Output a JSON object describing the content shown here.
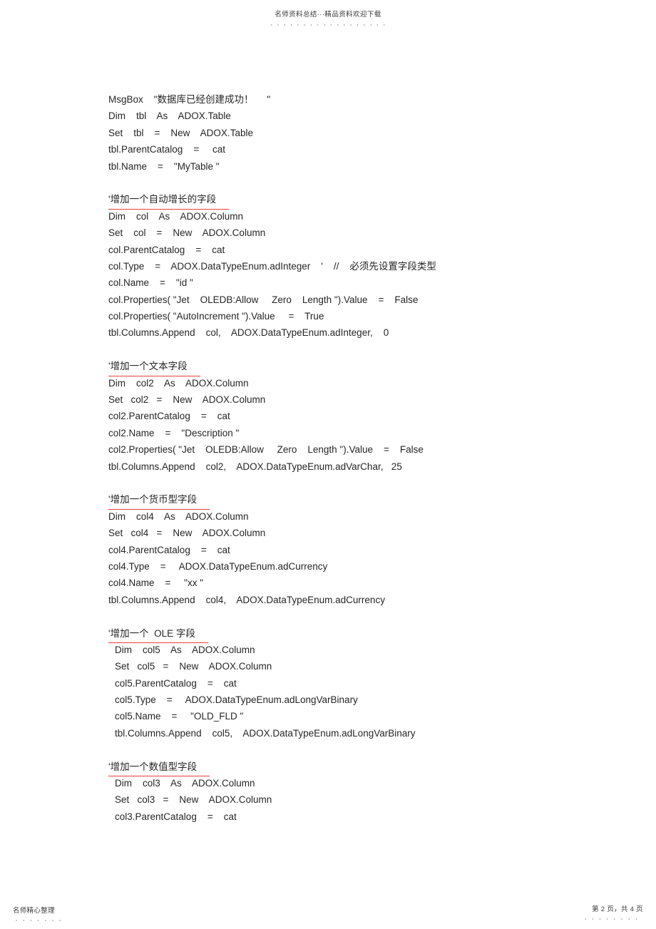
{
  "header": {
    "watermark": "名师资料总结···精品资料欢迎下载"
  },
  "footer": {
    "left_text": "名师精心整理",
    "page_indicator": "第 2 页，共 4 页"
  },
  "document": {
    "blocks": [
      {
        "kind": "code",
        "lines": [
          "MsgBox    \"数据库已经创建成功！     \"",
          "Dim    tbl    As    ADOX.Table",
          "Set    tbl    =    New    ADOX.Table",
          "tbl.ParentCatalog    =     cat",
          "tbl.Name    =    \"MyTable \""
        ]
      },
      {
        "kind": "blank"
      },
      {
        "kind": "comment",
        "text": "'增加一个自动增长的字段"
      },
      {
        "kind": "code",
        "lines": [
          "Dim    col    As    ADOX.Column",
          "Set    col    =    New    ADOX.Column",
          "col.ParentCatalog    =    cat",
          "col.Type    =    ADOX.DataTypeEnum.adInteger    '    //    必须先设置字段类型",
          "col.Name    =    \"id \"",
          "col.Properties( \"Jet    OLEDB:Allow     Zero    Length \").Value    =    False",
          "col.Properties( \"AutoIncrement \").Value     =    True",
          "tbl.Columns.Append    col,    ADOX.DataTypeEnum.adInteger,    0"
        ]
      },
      {
        "kind": "blank"
      },
      {
        "kind": "comment",
        "text": "'增加一个文本字段"
      },
      {
        "kind": "code",
        "lines": [
          "Dim    col2    As    ADOX.Column",
          "Set   col2   =    New    ADOX.Column",
          "col2.ParentCatalog    =    cat",
          "col2.Name    =    \"Description \"",
          "col2.Properties( \"Jet    OLEDB:Allow     Zero    Length \").Value    =    False",
          "tbl.Columns.Append    col2,    ADOX.DataTypeEnum.adVarChar,   25"
        ]
      },
      {
        "kind": "blank"
      },
      {
        "kind": "comment",
        "text": "'增加一个货币型字段"
      },
      {
        "kind": "code",
        "lines": [
          "Dim    col4    As    ADOX.Column",
          "Set   col4   =    New    ADOX.Column",
          "col4.ParentCatalog    =    cat",
          "col4.Type    =     ADOX.DataTypeEnum.adCurrency",
          "col4.Name    =     \"xx \"",
          "tbl.Columns.Append    col4,    ADOX.DataTypeEnum.adCurrency"
        ]
      },
      {
        "kind": "blank"
      },
      {
        "kind": "comment",
        "text": "'增加一个  OLE 字段"
      },
      {
        "kind": "code",
        "indent": true,
        "lines": [
          "Dim    col5    As    ADOX.Column",
          "Set   col5   =    New    ADOX.Column",
          "col5.ParentCatalog    =    cat",
          "col5.Type    =     ADOX.DataTypeEnum.adLongVarBinary",
          "col5.Name    =     \"OLD_FLD \"",
          "tbl.Columns.Append    col5,    ADOX.DataTypeEnum.adLongVarBinary"
        ]
      },
      {
        "kind": "blank"
      },
      {
        "kind": "comment",
        "text": "'增加一个数值型字段"
      },
      {
        "kind": "code",
        "indent": true,
        "lines": [
          "Dim    col3    As    ADOX.Column",
          "Set   col3   =    New    ADOX.Column",
          "col3.ParentCatalog    =    cat"
        ]
      }
    ]
  }
}
